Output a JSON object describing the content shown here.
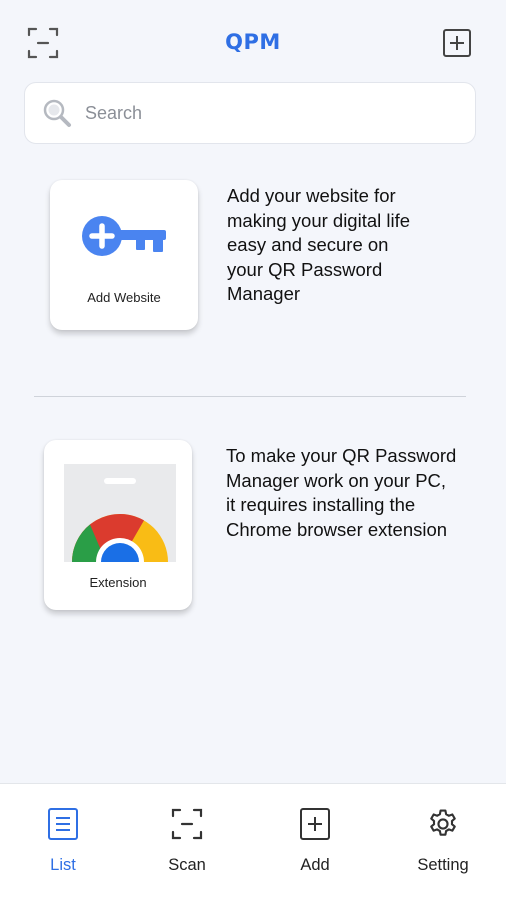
{
  "app": {
    "title": "QPM"
  },
  "colors": {
    "accent": "#2f6fe4",
    "background": "#f4f6fb"
  },
  "header": {
    "left_icon": "scan-frame-icon",
    "right_icon": "add-square-icon"
  },
  "search": {
    "placeholder": "Search",
    "value": ""
  },
  "cards": [
    {
      "label": "Add Website",
      "icon": "key-icon",
      "description": "Add your website for\nmaking your  digital life\neasy and secure on\nyour  QR Password\nManager"
    },
    {
      "label": "Extension",
      "icon": "chrome-icon",
      "description": "To make your QR Password\nManager work on your PC,\nit requires installing the\nChrome browser extension"
    }
  ],
  "nav": [
    {
      "label": "List",
      "icon": "list-icon",
      "active": true
    },
    {
      "label": "Scan",
      "icon": "scan-icon",
      "active": false
    },
    {
      "label": "Add",
      "icon": "add-icon",
      "active": false
    },
    {
      "label": "Setting",
      "icon": "gear-icon",
      "active": false
    }
  ]
}
